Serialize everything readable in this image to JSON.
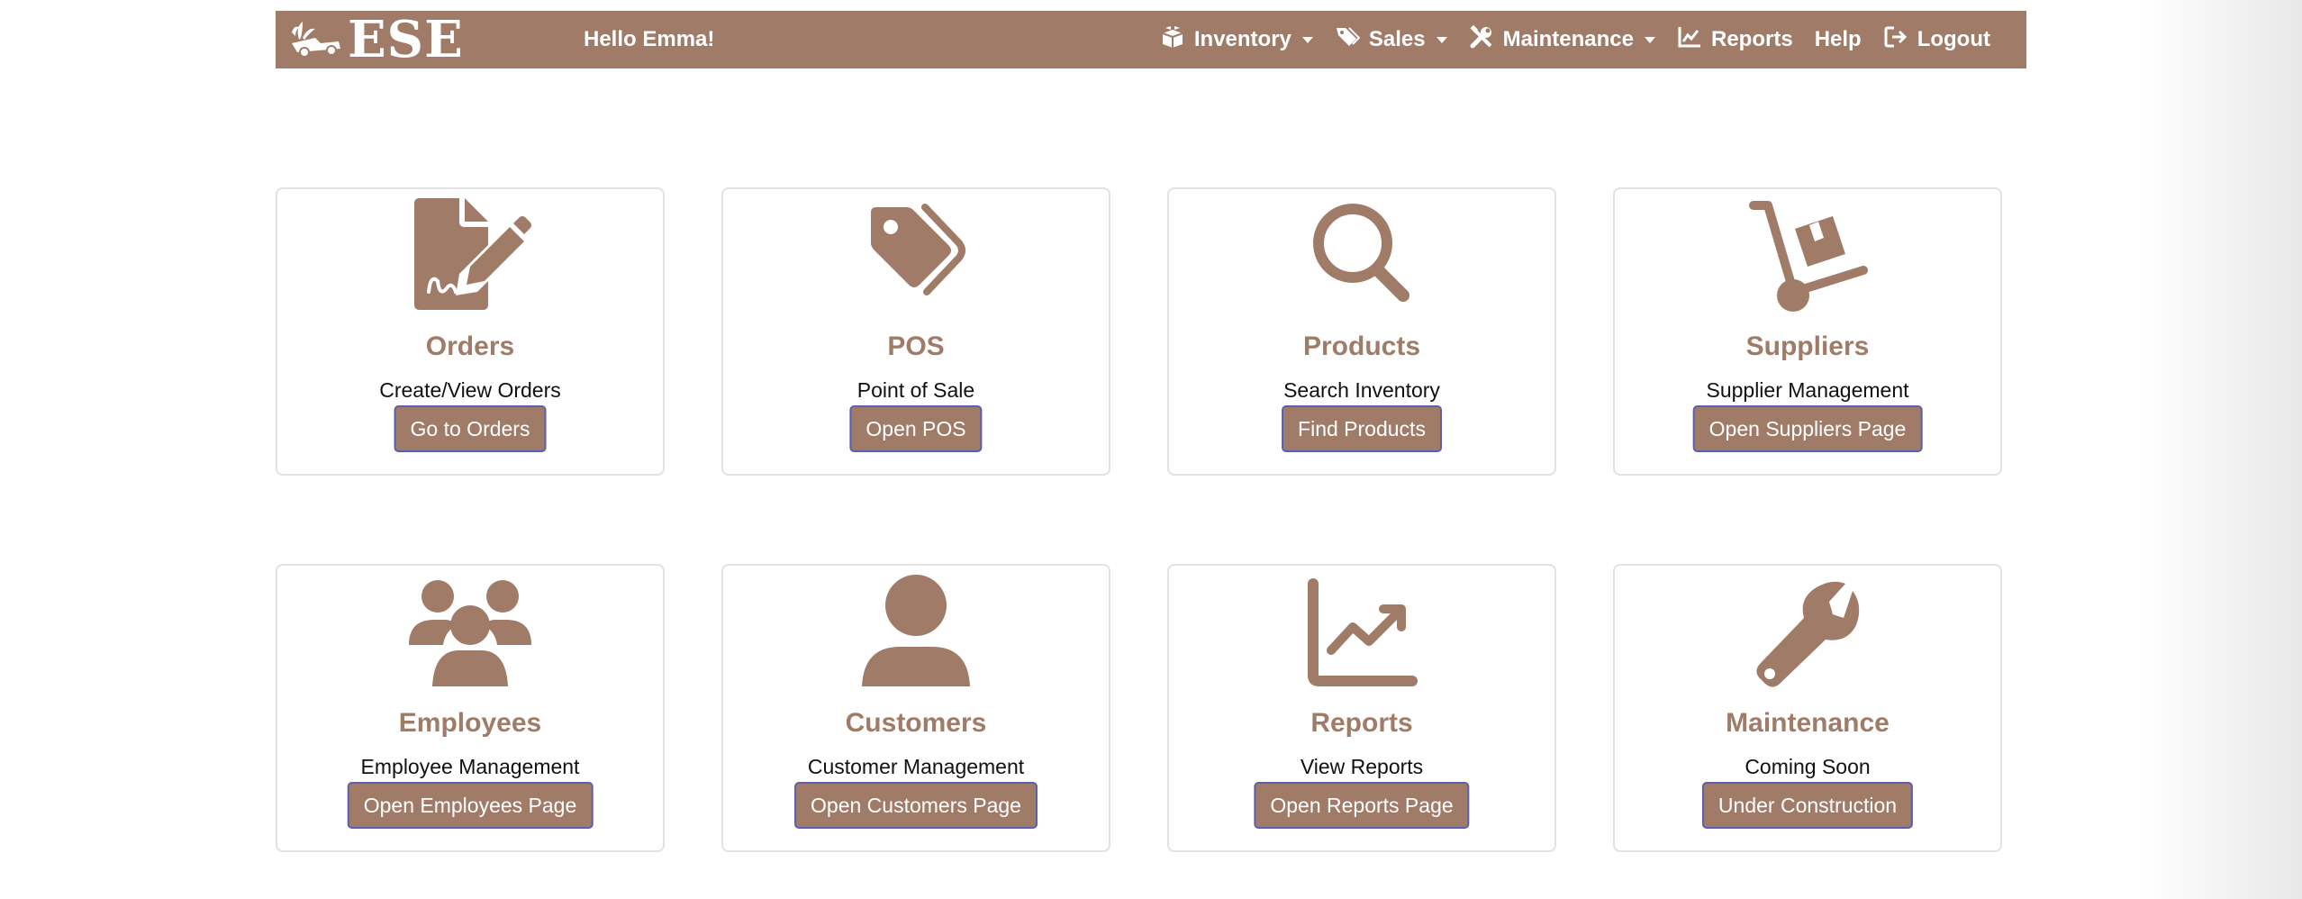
{
  "brand": {
    "text": "ESE",
    "logo_icon": "garden-cart-logo"
  },
  "navbar": {
    "greeting": "Hello Emma!",
    "items": [
      {
        "label": "Inventory",
        "icon": "boxes-icon",
        "dropdown": true
      },
      {
        "label": "Sales",
        "icon": "tags-icon",
        "dropdown": true
      },
      {
        "label": "Maintenance",
        "icon": "tools-icon",
        "dropdown": true
      },
      {
        "label": "Reports",
        "icon": "chart-line-icon",
        "dropdown": false
      },
      {
        "label": "Help",
        "icon": "",
        "dropdown": false
      },
      {
        "label": "Logout",
        "icon": "logout-icon",
        "dropdown": false
      }
    ]
  },
  "cards": [
    {
      "title": "Orders",
      "description": "Create/View Orders",
      "button": "Go to Orders",
      "icon": "file-signature-icon"
    },
    {
      "title": "POS",
      "description": "Point of Sale",
      "button": "Open POS",
      "icon": "tags-icon"
    },
    {
      "title": "Products",
      "description": "Search Inventory",
      "button": "Find Products",
      "icon": "search-icon"
    },
    {
      "title": "Suppliers",
      "description": "Supplier Management",
      "button": "Open Suppliers Page",
      "icon": "dolly-icon"
    },
    {
      "title": "Employees",
      "description": "Employee Management",
      "button": "Open Employees Page",
      "icon": "users-icon"
    },
    {
      "title": "Customers",
      "description": "Customer Management",
      "button": "Open Customers Page",
      "icon": "user-icon"
    },
    {
      "title": "Reports",
      "description": "View Reports",
      "button": "Open Reports Page",
      "icon": "chart-line-icon"
    },
    {
      "title": "Maintenance",
      "description": "Coming Soon",
      "button": "Under Construction",
      "icon": "wrench-icon"
    }
  ],
  "colors": {
    "brand": "#a07b68",
    "button_border": "#5a5fb0",
    "card_border": "#e2e2e2"
  }
}
